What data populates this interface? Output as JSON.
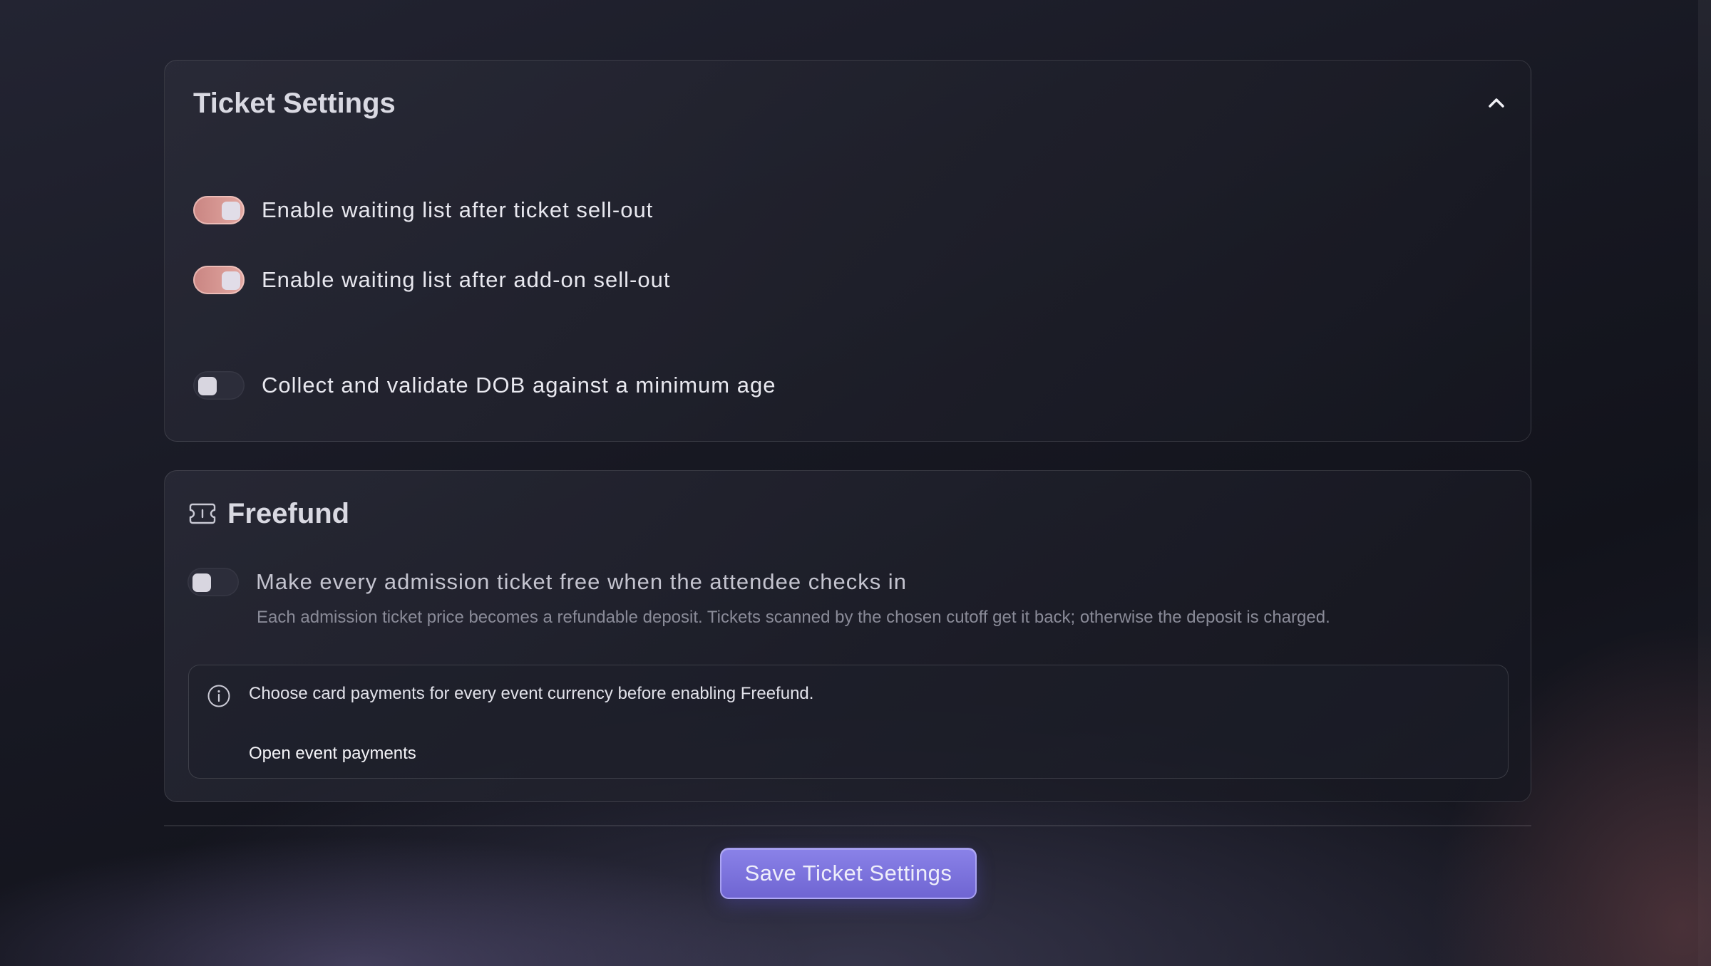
{
  "ticket_settings": {
    "title": "Ticket Settings",
    "toggles": [
      {
        "label": "Enable waiting list after ticket sell-out",
        "enabled": true
      },
      {
        "label": "Enable waiting list after add-on sell-out",
        "enabled": true
      },
      {
        "label": "Collect and validate DOB against a minimum age",
        "enabled": false
      }
    ],
    "collapse_icon": "chevron-up-icon"
  },
  "freefund": {
    "title": "Freefund",
    "icon": "ticket-icon",
    "toggle": {
      "label": "Make every admission ticket free when the attendee checks in",
      "enabled": false
    },
    "description": "Each admission ticket price becomes a refundable deposit. Tickets scanned by the chosen cutoff get it back; otherwise the deposit is charged.",
    "notice": {
      "icon": "info-icon",
      "text": "Choose card payments for every event currency before enabling Freefund.",
      "link_label": "Open event payments"
    }
  },
  "footer": {
    "save_label": "Save Ticket Settings"
  },
  "colors": {
    "toggle_on": "#d89a95",
    "toggle_off": "#2c2d3a",
    "primary_button": "#7a70dc",
    "background": "#161720"
  }
}
